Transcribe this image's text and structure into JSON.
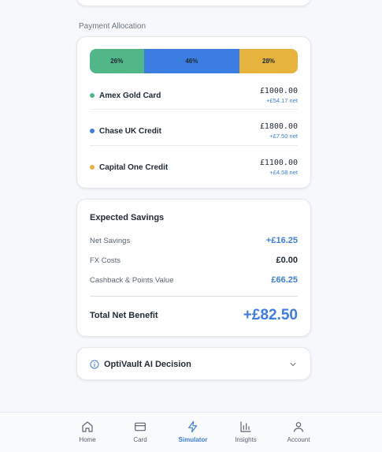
{
  "colors": {
    "green": "#52b788",
    "blue": "#3b7de0",
    "amber": "#e6b33c",
    "accent": "#3b7de0",
    "text_dark": "#1f2933",
    "muted": "#5a6472"
  },
  "allocation": {
    "section_label": "Payment Allocation",
    "bar": [
      {
        "label": "26%",
        "fraction": 0.26,
        "color": "#52b788"
      },
      {
        "label": "46%",
        "fraction": 0.46,
        "color": "#3b7de0"
      },
      {
        "label": "28%",
        "fraction": 0.28,
        "color": "#e6b33c"
      }
    ],
    "rows": [
      {
        "name": "Amex Gold Card",
        "amount": "£1000.00",
        "net": "+£54.17 net",
        "color": "#52b788"
      },
      {
        "name": "Chase UK Credit",
        "amount": "£1800.00",
        "net": "+£7.50 net",
        "color": "#3b7de0"
      },
      {
        "name": "Capital One Credit",
        "amount": "£1100.00",
        "net": "+£4.58 net",
        "color": "#e6b33c"
      }
    ]
  },
  "savings": {
    "title": "Expected Savings",
    "rows": [
      {
        "label": "Net Savings",
        "value": "+£16.25",
        "color": "#3b7de0"
      },
      {
        "label": "FX Costs",
        "value": "£0.00",
        "color": "#1f2933"
      },
      {
        "label": "Cashback & Points Value",
        "value": "£66.25",
        "color": "#3b7de0"
      }
    ],
    "total_label": "Total Net Benefit",
    "total_value": "+£82.50"
  },
  "ai_decision": {
    "title": "OptiVault AI Decision",
    "icon": "info-icon",
    "toggle_icon": "chevron-down-icon"
  },
  "nav": {
    "items": [
      {
        "label": "Home",
        "icon": "home-icon",
        "active": false
      },
      {
        "label": "Card",
        "icon": "credit-card-icon",
        "active": false
      },
      {
        "label": "Simulator",
        "icon": "lightning-icon",
        "active": true
      },
      {
        "label": "Insights",
        "icon": "bar-chart-icon",
        "active": false
      },
      {
        "label": "Account",
        "icon": "user-icon",
        "active": false
      }
    ]
  }
}
